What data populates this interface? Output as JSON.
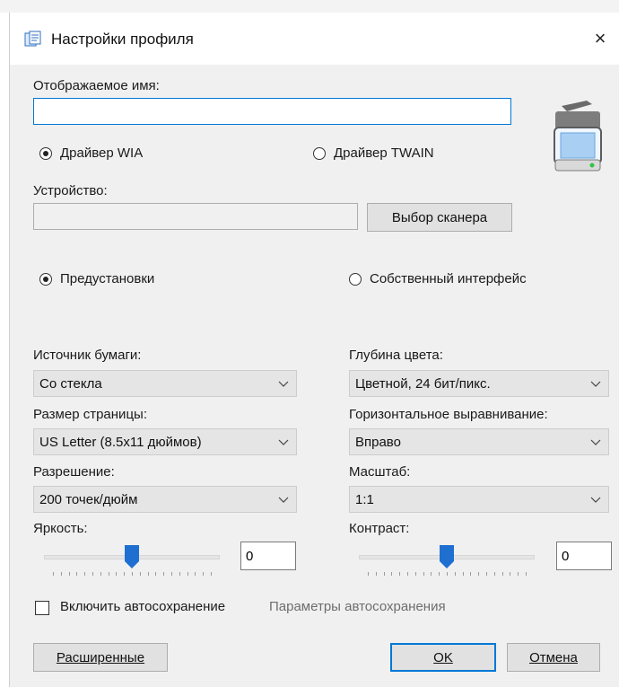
{
  "window": {
    "title": "Настройки профиля",
    "close_symbol": "×",
    "app_icon": "settings-profile-icon"
  },
  "display_name": {
    "label": "Отображаемое имя:",
    "value": ""
  },
  "driver": {
    "options": [
      "Драйвер WIA",
      "Драйвер TWAIN"
    ],
    "selected": "Драйвер WIA"
  },
  "device": {
    "label": "Устройство:",
    "value": "",
    "select_button": "Выбор сканера"
  },
  "mode": {
    "options": [
      "Предустановки",
      "Собственный интерфейс"
    ],
    "selected": "Предустановки"
  },
  "settings": {
    "paper_source": {
      "label": "Источник бумаги:",
      "value": "Со стекла"
    },
    "color_depth": {
      "label": "Глубина цвета:",
      "value": "Цветной, 24 бит/пикс."
    },
    "page_size": {
      "label": "Размер страницы:",
      "value": "US Letter (8.5x11 дюймов)"
    },
    "horizontal_align": {
      "label": "Горизонтальное выравнивание:",
      "value": "Вправо"
    },
    "resolution": {
      "label": "Разрешение:",
      "value": "200 точек/дюйм"
    },
    "scale": {
      "label": "Масштаб:",
      "value": "1:1"
    }
  },
  "brightness": {
    "label": "Яркость:",
    "value": "0",
    "level_fraction": 0.5
  },
  "contrast": {
    "label": "Контраст:",
    "value": "0",
    "level_fraction": 0.5
  },
  "autosave": {
    "label": "Включить автосохранение",
    "checked": false,
    "settings_link": "Параметры автосохранения"
  },
  "buttons": {
    "advanced": "Расширенные",
    "ok": "OK",
    "cancel": "Отмена"
  },
  "colors": {
    "accent": "#0078d7",
    "thumb": "#1f6fd1",
    "dialog_bg": "#f0f0f0"
  }
}
